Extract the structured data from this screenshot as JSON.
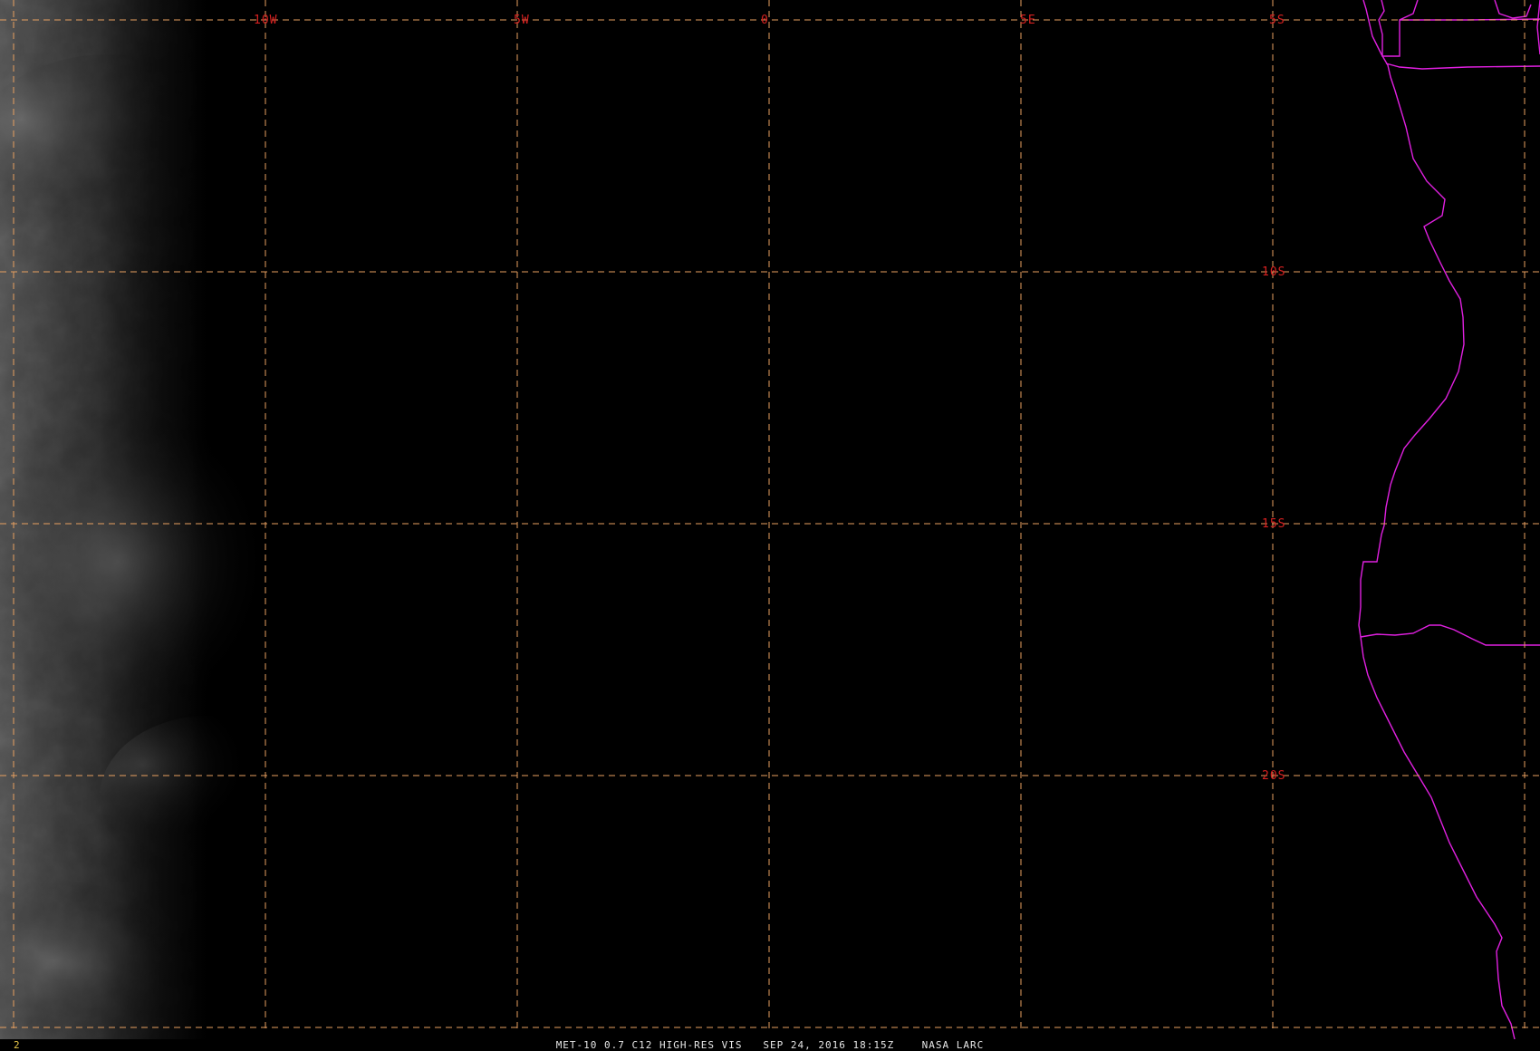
{
  "map": {
    "background": "#000000",
    "grid_color": "#e8a060",
    "label_color": "#d62020",
    "boundary_color": "#e020e0",
    "longitude_labels": [
      "10W",
      "5W",
      "0",
      "5E"
    ],
    "latitude_labels": [
      "5S",
      "10S",
      "15S",
      "20S"
    ]
  },
  "status_bar": {
    "frame_number": "2",
    "caption": "MET-10 0.7 C12 HIGH-RES VIS   SEP 24, 2016 18:15Z    NASA LARC",
    "frame_color": "#e8c84a",
    "caption_color": "#e6e6e6"
  }
}
